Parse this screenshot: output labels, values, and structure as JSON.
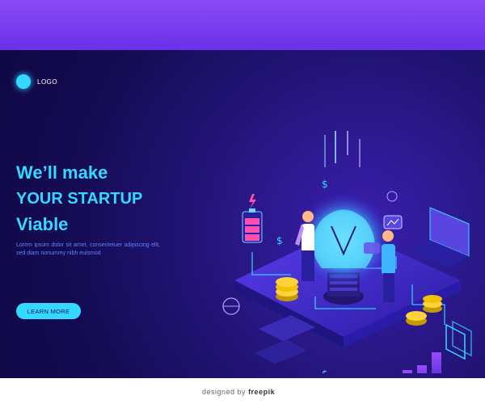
{
  "logo": {
    "label": "LOGO"
  },
  "hero": {
    "line1": "We’ll make",
    "line2": "YOUR STARTUP",
    "line3": "Viable",
    "lorem": "Lorem ipsum dolor sit amet, consectetuer adipiscing elit, sed diam nonummy nibh euismod",
    "cta": "LEARN MORE"
  },
  "watermark": {
    "prefix": "designed by",
    "brand": "freepik"
  },
  "colors": {
    "accent": "#35d8ff",
    "card_bg": "#150c55",
    "band": "#6b31e8"
  }
}
